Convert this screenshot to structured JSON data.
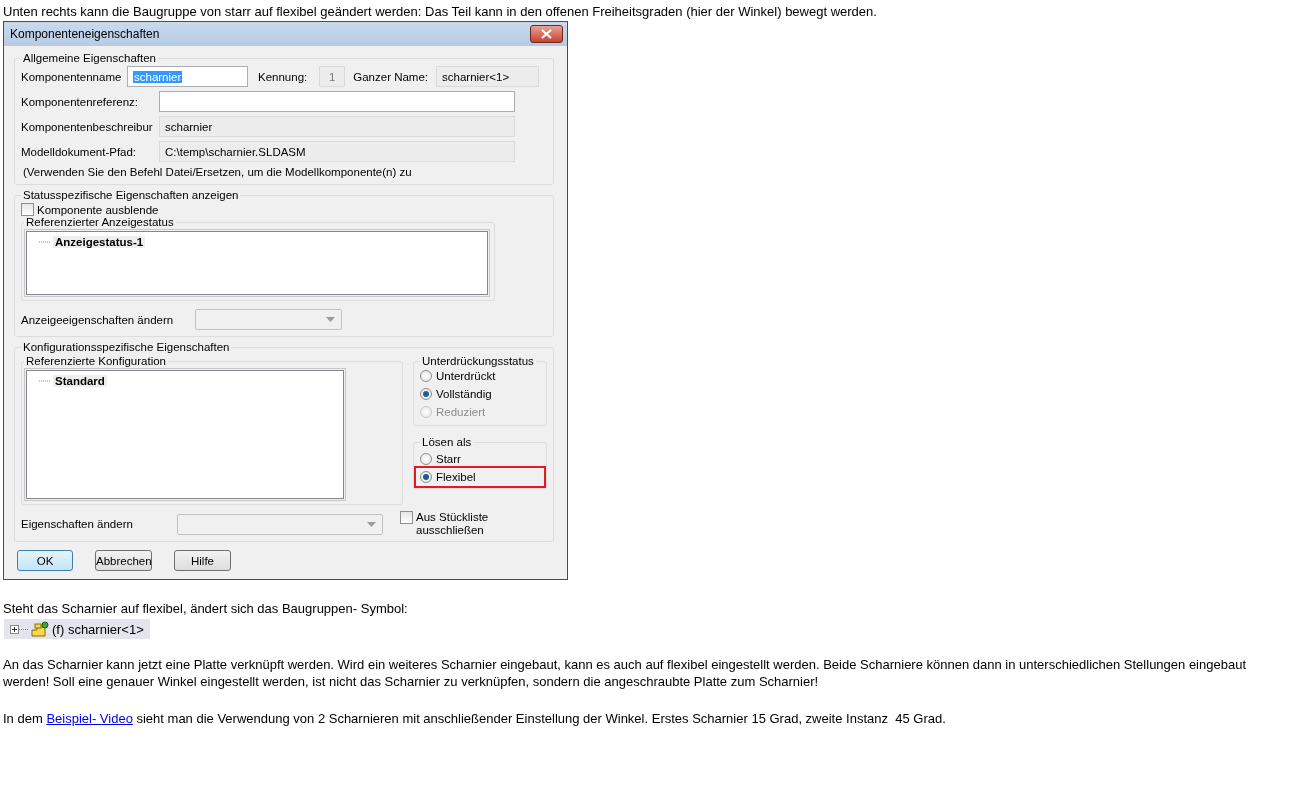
{
  "intro": "Unten rechts kann die Baugruppe von starr auf flexibel geändert werden: Das Teil kann in den offenen Freiheitsgraden (hier der Winkel) bewegt werden.",
  "dialog": {
    "title": "Komponenteneigenschaften",
    "general": {
      "legend": "Allgemeine Eigenschaften",
      "name_label": "Komponentenname",
      "name_value": "scharnier",
      "name_value_selected": true,
      "id_label": "Kennung:",
      "id_value": "1",
      "full_name_label": "Ganzer Name:",
      "full_name_value": "scharnier<1>",
      "reference_label": "Komponentenreferenz:",
      "description_label": "Komponentenbeschreibur",
      "description_value": "scharnier",
      "path_label": "Modelldokument-Pfad:",
      "path_value": "C:\\temp\\scharnier.SLDASM",
      "note": "(Verwenden Sie den Befehl Datei/Ersetzen, um die Modellkomponente(n) zu"
    },
    "display": {
      "legend": "Statusspezifische Eigenschaften anzeigen",
      "hide_checkbox": {
        "label": "Komponente ausblende",
        "checked": false
      },
      "tree_legend": "Referenzierter Anzeigestatus",
      "tree_items": [
        {
          "label": "Anzeigestatus-1",
          "selected": true
        }
      ],
      "change_label": "Anzeigeeigenschaften ändern"
    },
    "configuration": {
      "legend": "Konfigurationsspezifische Eigenschaften",
      "tree_legend": "Referenzierte Konfiguration",
      "tree_items": [
        {
          "label": "Standard",
          "selected": true
        }
      ],
      "suppression": {
        "legend": "Unterdrückungsstatus",
        "options": [
          {
            "label": "Unterdrückt",
            "selected": false,
            "disabled": false,
            "highlighted": false
          },
          {
            "label": "Vollständig",
            "selected": true,
            "disabled": false,
            "highlighted": false
          },
          {
            "label": "Reduziert",
            "selected": false,
            "disabled": true,
            "highlighted": false
          }
        ]
      },
      "solve_as": {
        "legend": "Lösen als",
        "options": [
          {
            "label": "Starr",
            "selected": false,
            "disabled": false,
            "highlighted": false
          },
          {
            "label": "Flexibel",
            "selected": true,
            "disabled": false,
            "highlighted": true
          }
        ]
      },
      "change_label": "Eigenschaften ändern",
      "exclude_checkbox": {
        "label": "Aus Stückliste ausschließen",
        "checked": false
      }
    },
    "buttons": [
      {
        "label": "OK",
        "default": true
      },
      {
        "label": "Abbrechen",
        "default": false
      },
      {
        "label": "Hilfe",
        "default": false
      }
    ]
  },
  "caption": "Steht das Scharnier auf flexibel, ändert sich das Baugruppen- Symbol:",
  "tree_node": {
    "label": "(f) scharnier<1>",
    "expanded": false
  },
  "paragraph": "An das Scharnier kann jetzt eine Platte verknüpft werden. Wird ein weiteres Scharnier eingebaut, kann es auch auf flexibel eingestellt werden. Beide Scharniere können dann in unterschiedlichen Stellungen eingebaut werden! Soll eine genauer Winkel eingestellt werden, ist nicht das Scharnier zu verknüpfen, sondern die angeschraubte Platte zum Scharnier!",
  "last": {
    "before": "In dem",
    "link": "Beispiel- Video",
    "after": "sieht man die Verwendung von 2 Scharnieren mit anschließender Einstellung der Winkel. Erstes Scharnier 15 Grad, zweite Instanz  45 Grad."
  }
}
